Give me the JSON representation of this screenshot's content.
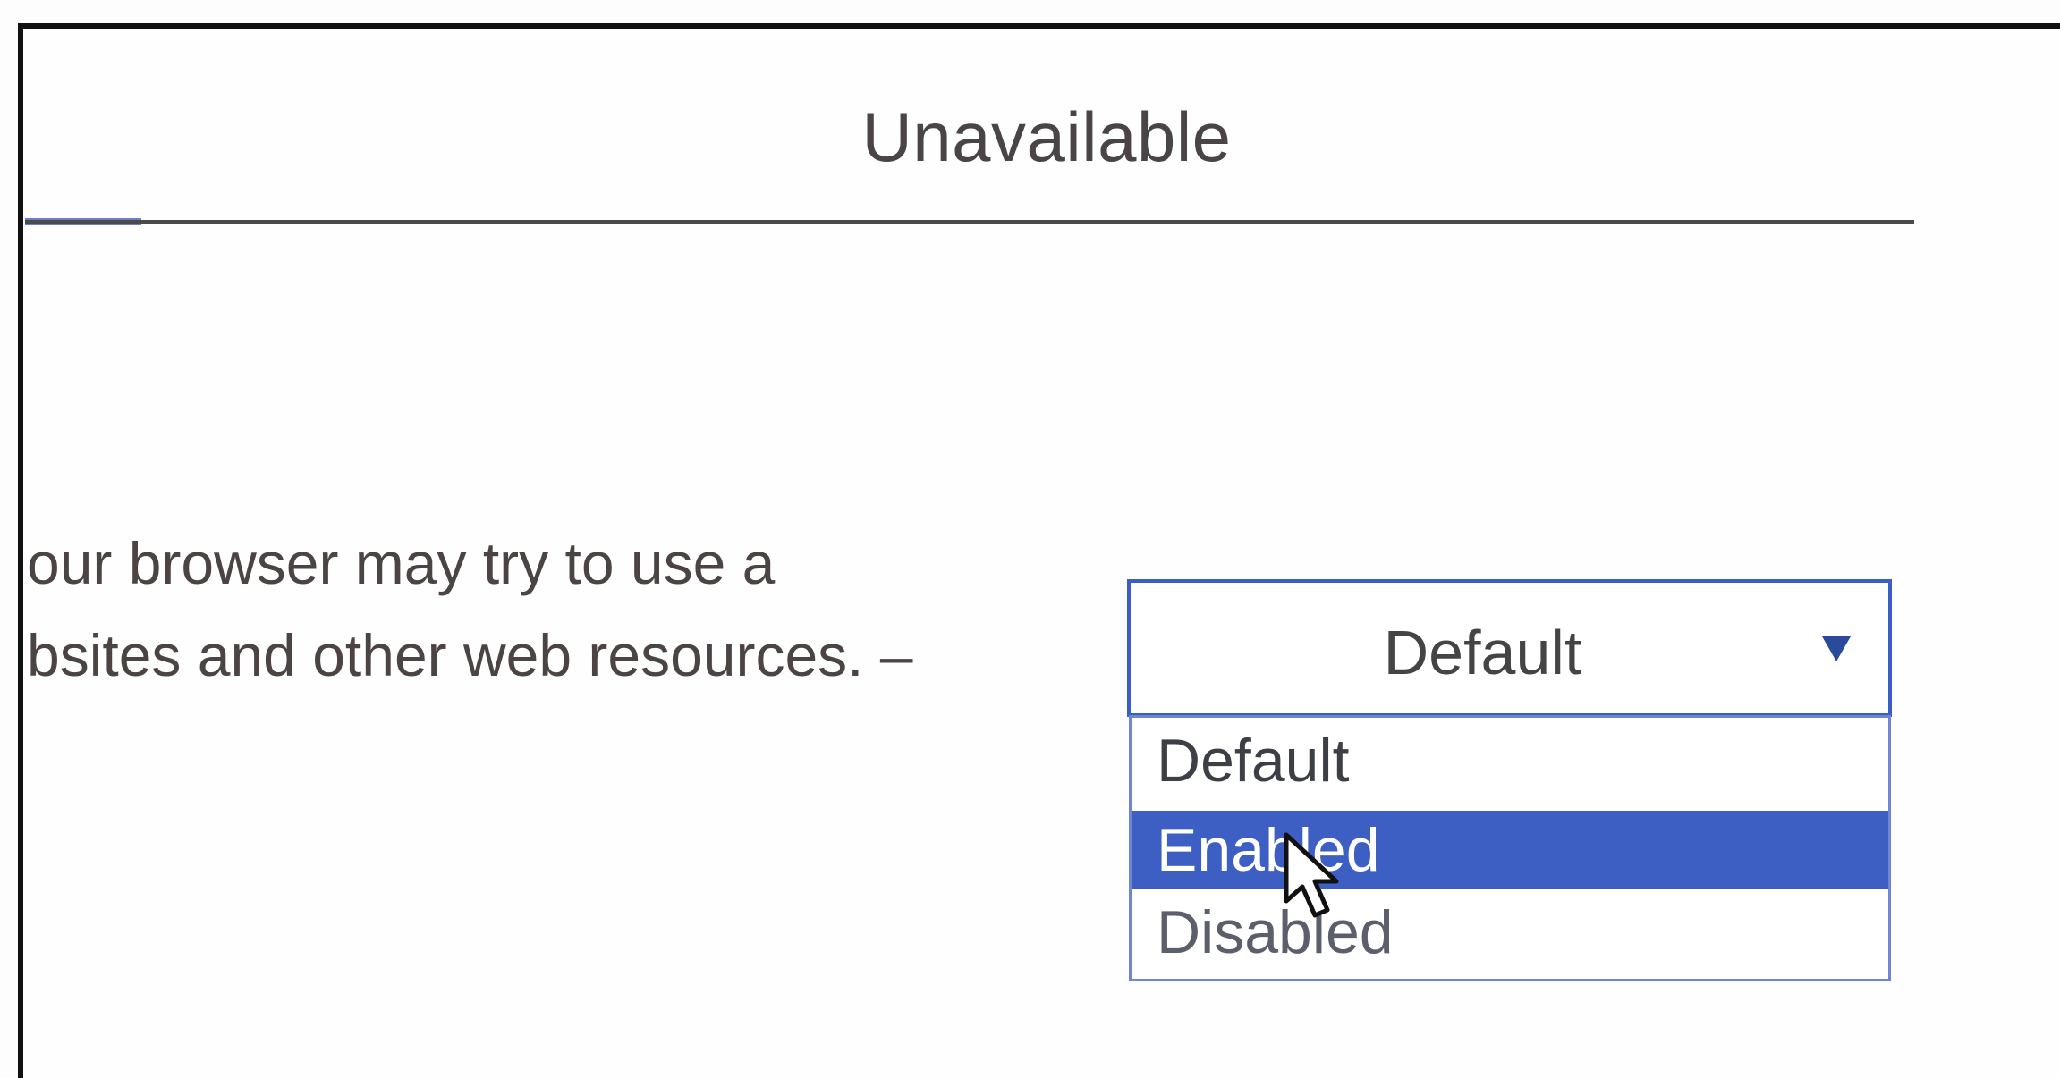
{
  "panel": {
    "title": "Unavailable"
  },
  "setting": {
    "description_line1": "our browser may try to use a",
    "description_line2": "bsites and other web resources. –"
  },
  "dropdown": {
    "selected_value": "Default",
    "options": [
      {
        "label": "Default",
        "highlighted": false
      },
      {
        "label": "Enabled",
        "highlighted": true
      },
      {
        "label": "Disabled",
        "highlighted": false
      }
    ]
  },
  "colors": {
    "accent": "#3d5fc4",
    "text": "#4c4443"
  },
  "icons": {
    "arrow": "triangle-down",
    "cursor": "mouse-pointer"
  }
}
